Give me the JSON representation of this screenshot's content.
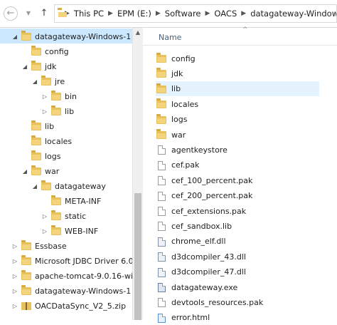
{
  "address": {
    "back_icon": "back-arrow-icon",
    "breadcrumbs": [
      "This PC",
      "EPM (E:)",
      "Software",
      "OACS",
      "datagateway-Windows"
    ]
  },
  "tree": [
    {
      "label": "datagateway-Windows-1",
      "indent": 0,
      "exp": "open",
      "icon": "folder",
      "sel": true
    },
    {
      "label": "config",
      "indent": 1,
      "exp": "",
      "icon": "folder"
    },
    {
      "label": "jdk",
      "indent": 1,
      "exp": "open",
      "icon": "folder"
    },
    {
      "label": "jre",
      "indent": 2,
      "exp": "open",
      "icon": "folder"
    },
    {
      "label": "bin",
      "indent": 3,
      "exp": "closed",
      "icon": "folder"
    },
    {
      "label": "lib",
      "indent": 3,
      "exp": "closed",
      "icon": "folder"
    },
    {
      "label": "lib",
      "indent": 1,
      "exp": "",
      "icon": "folder"
    },
    {
      "label": "locales",
      "indent": 1,
      "exp": "",
      "icon": "folder"
    },
    {
      "label": "logs",
      "indent": 1,
      "exp": "",
      "icon": "folder"
    },
    {
      "label": "war",
      "indent": 1,
      "exp": "open",
      "icon": "folder"
    },
    {
      "label": "datagateway",
      "indent": 2,
      "exp": "open",
      "icon": "folder"
    },
    {
      "label": "META-INF",
      "indent": 3,
      "exp": "",
      "icon": "folder"
    },
    {
      "label": "static",
      "indent": 3,
      "exp": "closed",
      "icon": "folder"
    },
    {
      "label": "WEB-INF",
      "indent": 3,
      "exp": "closed",
      "icon": "folder"
    },
    {
      "label": "Essbase",
      "indent": 0,
      "exp": "closed",
      "icon": "folder"
    },
    {
      "label": "Microsoft JDBC Driver 6.0",
      "indent": 0,
      "exp": "closed",
      "icon": "folder"
    },
    {
      "label": "apache-tomcat-9.0.16-wi",
      "indent": 0,
      "exp": "closed",
      "icon": "folder"
    },
    {
      "label": "datagateway-Windows-1",
      "indent": 0,
      "exp": "closed",
      "icon": "folder"
    },
    {
      "label": "OACDataSync_V2_5.zip",
      "indent": 0,
      "exp": "closed",
      "icon": "zip"
    }
  ],
  "list": {
    "column_header": "Name",
    "items": [
      {
        "label": "config",
        "icon": "folder"
      },
      {
        "label": "jdk",
        "icon": "folder"
      },
      {
        "label": "lib",
        "icon": "folder",
        "hl": true
      },
      {
        "label": "locales",
        "icon": "folder"
      },
      {
        "label": "logs",
        "icon": "folder"
      },
      {
        "label": "war",
        "icon": "folder"
      },
      {
        "label": "agentkeystore",
        "icon": "file"
      },
      {
        "label": "cef.pak",
        "icon": "file"
      },
      {
        "label": "cef_100_percent.pak",
        "icon": "file"
      },
      {
        "label": "cef_200_percent.pak",
        "icon": "file"
      },
      {
        "label": "cef_extensions.pak",
        "icon": "file"
      },
      {
        "label": "cef_sandbox.lib",
        "icon": "file"
      },
      {
        "label": "chrome_elf.dll",
        "icon": "dll"
      },
      {
        "label": "d3dcompiler_43.dll",
        "icon": "dll"
      },
      {
        "label": "d3dcompiler_47.dll",
        "icon": "dll"
      },
      {
        "label": "datagateway.exe",
        "icon": "exe"
      },
      {
        "label": "devtools_resources.pak",
        "icon": "file"
      },
      {
        "label": "error.html",
        "icon": "html"
      }
    ]
  }
}
